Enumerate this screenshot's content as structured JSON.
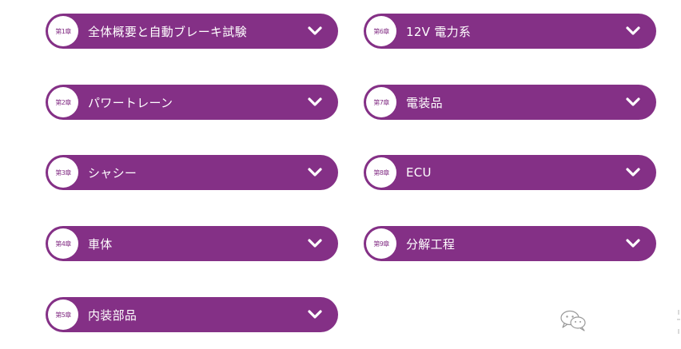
{
  "chapters": [
    {
      "badge": "第1章",
      "title": "全体概要と自動ブレーキ試験"
    },
    {
      "badge": "第2章",
      "title": "パワートレーン"
    },
    {
      "badge": "第3章",
      "title": "シャシー"
    },
    {
      "badge": "第4章",
      "title": "車体"
    },
    {
      "badge": "第5章",
      "title": "内装部品"
    },
    {
      "badge": "第6章",
      "title": "12V 電力系"
    },
    {
      "badge": "第7章",
      "title": "電装品"
    },
    {
      "badge": "第8章",
      "title": "ECU"
    },
    {
      "badge": "第9章",
      "title": "分解工程"
    }
  ],
  "icons": {
    "expand": "chevron-down-icon",
    "watermark": "wechat-icon"
  },
  "colors": {
    "pill": "#843086",
    "badge_bg": "#ffffff",
    "text": "#ffffff",
    "badge_text": "#843086"
  }
}
